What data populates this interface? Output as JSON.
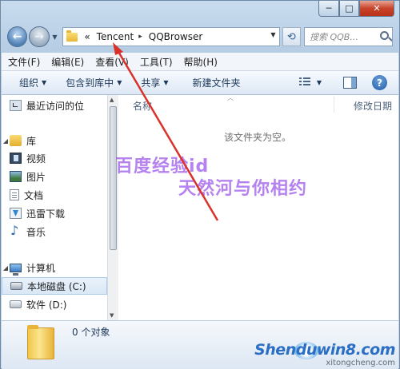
{
  "window": {
    "caption": {
      "minimize": "─",
      "maximize": "□",
      "close": "✕"
    }
  },
  "nav": {
    "back": "←",
    "forward": "→"
  },
  "address": {
    "prefix": "«",
    "crumbs": [
      "Tencent",
      "QQBrowser"
    ],
    "separator": "▸"
  },
  "search": {
    "placeholder": "搜索 QQB..."
  },
  "menu": [
    "文件(F)",
    "编辑(E)",
    "查看(V)",
    "工具(T)",
    "帮助(H)"
  ],
  "commands": {
    "organize": "组织",
    "include_in_library": "包含到库中",
    "share": "共享",
    "new_folder": "新建文件夹",
    "help": "?"
  },
  "navpane": {
    "recent": "最近访问的位",
    "library": "库",
    "video": "视频",
    "pictures": "图片",
    "documents": "文档",
    "xunlei": "迅雷下载",
    "music": "音乐",
    "computer": "计算机",
    "local_disk": "本地磁盘 (C:)",
    "software_disk": "软件 (D:)"
  },
  "content": {
    "col_name": "名称",
    "col_date": "修改日期",
    "empty": "该文件夹为空。"
  },
  "watermark": {
    "line1": "百度经验id",
    "line2": "天然河与你相约"
  },
  "status": {
    "count": "0 个对象"
  },
  "brand": {
    "main": "Shenduwin8.com",
    "sub": "xitongcheng.com"
  },
  "colors": {
    "arrow": "#d9322a",
    "watermark": "#a05feb",
    "brand": "#2b6fc4"
  }
}
